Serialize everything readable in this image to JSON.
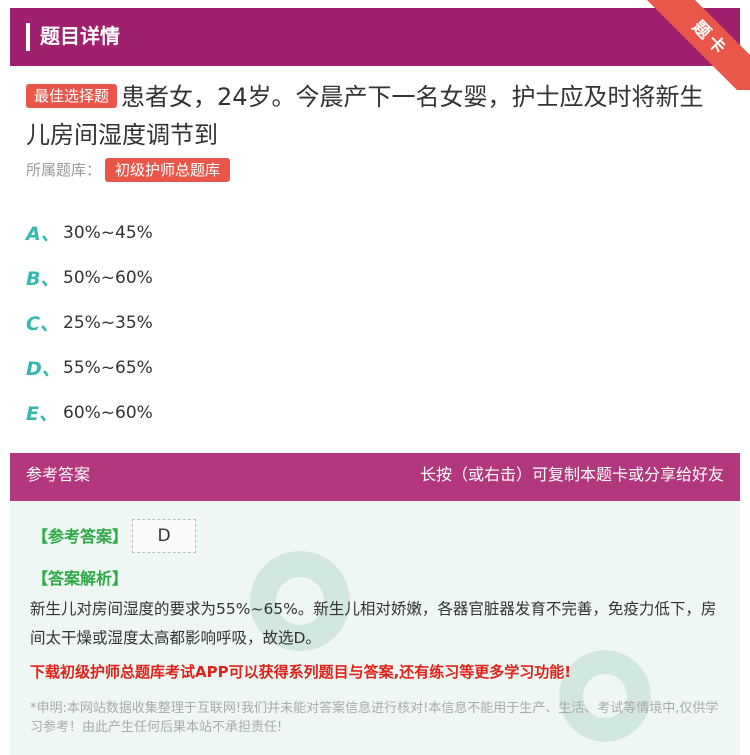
{
  "header": {
    "title": "题目详情",
    "ribbon": "题卡"
  },
  "question": {
    "tag": "最佳选择题",
    "text": "患者女，24岁。今晨产下一名女婴，护士应及时将新生儿房间湿度调节到",
    "bank_label": "所属题库：",
    "bank_name": "初级护师总题库"
  },
  "options": [
    {
      "letter": "A、",
      "text": "30%~45%"
    },
    {
      "letter": "B、",
      "text": "50%~60%"
    },
    {
      "letter": "C、",
      "text": "25%~35%"
    },
    {
      "letter": "D、",
      "text": "55%~65%"
    },
    {
      "letter": "E、",
      "text": "60%~60%"
    }
  ],
  "answer": {
    "head_left": "参考答案",
    "head_right": "长按（或右击）可复制本题卡或分享给好友",
    "answer_label": "【参考答案】",
    "answer_value": "D",
    "analysis_label": "【答案解析】",
    "analysis_text": "新生儿对房间湿度的要求为55%~65%。新生儿相对娇嫩，各器官脏器发育不完善，免疫力低下，房间太干燥或湿度太高都影响呼吸，故选D。",
    "promo": "下载初级护师总题库考试APP可以获得系列题目与答案,还有练习等更多学习功能!",
    "disclaimer": "*申明:本网站数据收集整理于互联网!我们并未能对答案信息进行核对!本信息不能用于生产、生活、考试等情境中,仅供学习参考！由此产生任何后果本站不承担责任!"
  },
  "colors": {
    "header": "#a01f6f",
    "answer_head": "#b2377d",
    "accent": "#e8574a",
    "letter": "#35b8b0",
    "answer_bg": "#eef7f4"
  }
}
